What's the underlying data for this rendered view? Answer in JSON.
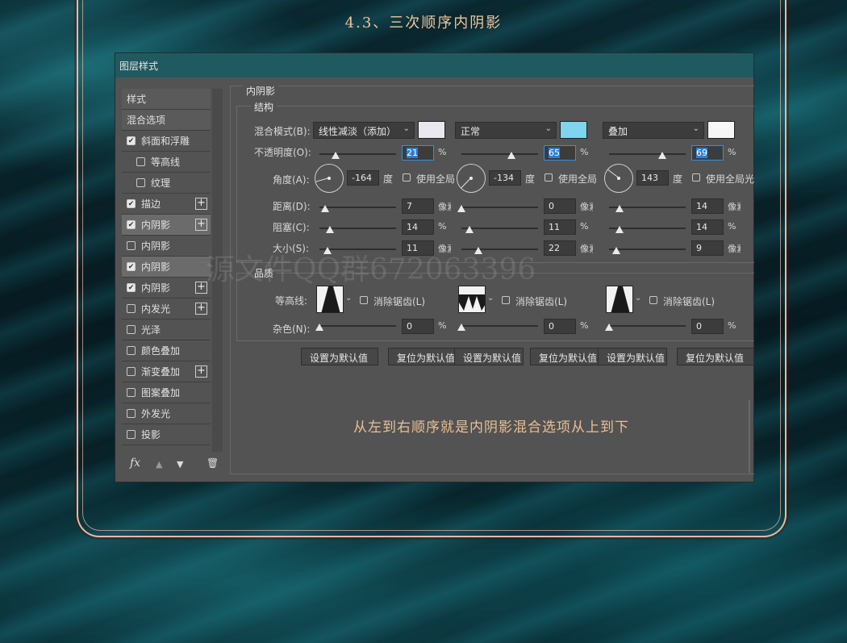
{
  "page_title": "4.3、三次顺序内阴影",
  "dialog": {
    "title": "图层样式",
    "section_title": "内阴影",
    "structure_title": "结构",
    "quality_title": "品质"
  },
  "styles_list": [
    {
      "label": "样式",
      "type": "header"
    },
    {
      "label": "混合选项",
      "type": "header"
    },
    {
      "label": "斜面和浮雕",
      "checked": true
    },
    {
      "label": "等高线",
      "checked": false,
      "indent": true
    },
    {
      "label": "纹理",
      "checked": false,
      "indent": true
    },
    {
      "label": "描边",
      "checked": true,
      "plus": true
    },
    {
      "label": "内阴影",
      "checked": true,
      "plus": true,
      "active": true
    },
    {
      "label": "内阴影",
      "checked": false
    },
    {
      "label": "内阴影",
      "checked": true,
      "active": true
    },
    {
      "label": "内阴影",
      "checked": true,
      "plus": true
    },
    {
      "label": "内发光",
      "checked": false,
      "plus": true
    },
    {
      "label": "光泽",
      "checked": false
    },
    {
      "label": "颜色叠加",
      "checked": false
    },
    {
      "label": "渐变叠加",
      "checked": false,
      "plus": true
    },
    {
      "label": "图案叠加",
      "checked": false
    },
    {
      "label": "外发光",
      "checked": false
    },
    {
      "label": "投影",
      "checked": false
    }
  ],
  "footer_icons": {
    "fx": "fx",
    "up": "▲",
    "down": "▼",
    "trash": "🗑"
  },
  "labels": {
    "blend_mode": "混合模式(B):",
    "opacity": "不透明度(O):",
    "angle": "角度(A):",
    "distance": "距离(D):",
    "choke": "阻塞(C):",
    "size": "大小(S):",
    "contour": "等高线:",
    "noise": "杂色(N):"
  },
  "columns": [
    {
      "blend_mode": "线性减淡（添加）",
      "color": "#e8e8ee",
      "opacity": "21",
      "opacity_fraction": 0.21,
      "angle": "-164",
      "angle_deg": -164,
      "global_light": "使用全局",
      "distance": "7",
      "distance_fraction": 0.07,
      "distance_unit": "像素",
      "choke": "14",
      "choke_fraction": 0.14,
      "size": "11",
      "size_fraction": 0.11,
      "size_unit": "像素",
      "antialias": "消除锯齿(L)",
      "noise": "0",
      "reset": "设置为默认值",
      "contour": "cone"
    },
    {
      "blend_mode": "正常",
      "color": "#7dd6ee",
      "opacity": "65",
      "opacity_fraction": 0.65,
      "angle": "-134",
      "angle_deg": -134,
      "global_light": "使用全局",
      "distance": "0",
      "distance_fraction": 0.0,
      "distance_unit": "像素",
      "choke": "11",
      "choke_fraction": 0.11,
      "size": "22",
      "size_fraction": 0.22,
      "size_unit": "像素",
      "antialias": "消除锯齿(L)",
      "noise": "0",
      "reset": "复位为默认值",
      "set_default": "设置为默认值",
      "contour": "ring"
    },
    {
      "blend_mode": "叠加",
      "color": "#f6f6f6",
      "opacity": "69",
      "opacity_fraction": 0.69,
      "angle": "143",
      "angle_deg": 143,
      "global_light": "使用全局光",
      "distance": "14",
      "distance_fraction": 0.14,
      "distance_unit": "像素",
      "choke": "14",
      "choke_fraction": 0.14,
      "size": "9",
      "size_fraction": 0.09,
      "size_unit": "像素",
      "antialias": "消除锯齿(L)",
      "noise": "0",
      "reset": "复位为默认值",
      "set_default": "设置为默认值",
      "contour": "cone"
    }
  ],
  "col0_distance_unit_clipped": "像素",
  "col0_size_unit_clipped": "像素",
  "percent": "%",
  "degree": "度",
  "caption": "从左到右顺序就是内阴影混合选项从上到下",
  "watermark": "源文件QQ群672063396",
  "bottom_buttons": [
    "设置为默认值",
    "复位为默认值",
    "设置为默认值",
    "复位为默认值",
    "设置为默认值",
    "复位为默认值"
  ]
}
